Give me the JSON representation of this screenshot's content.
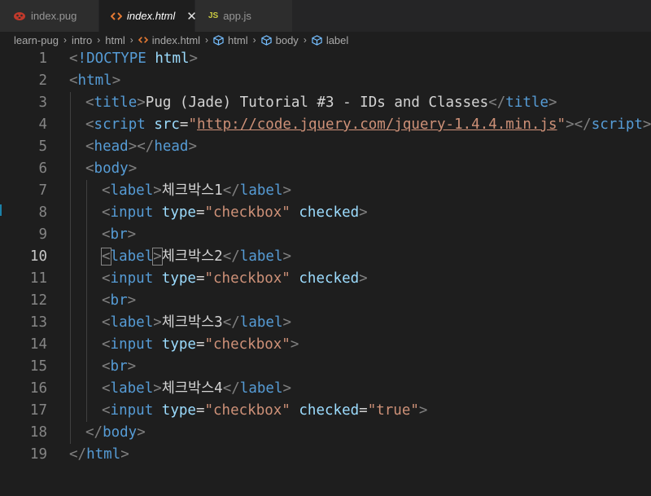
{
  "tabs": [
    {
      "label": "index.pug",
      "icon": "pug-icon",
      "active": false
    },
    {
      "label": "index.html",
      "icon": "html-icon",
      "active": true,
      "close": "✕"
    },
    {
      "label": "app.js",
      "icon": "js-icon",
      "badge": "JS",
      "active": false
    }
  ],
  "breadcrumb": [
    "learn-pug",
    "intro",
    "html",
    "index.html",
    "html",
    "body",
    "label"
  ],
  "colors": {
    "background": "#1e1e1e",
    "tag": "#569cd6",
    "attribute": "#9cdcfe",
    "string": "#ce9178",
    "punctuation": "#808080",
    "text": "#d4d4d4",
    "line_number": "#858585"
  },
  "editor": {
    "current_line": 10,
    "lines": [
      {
        "n": "1",
        "indent": 0,
        "tokens": [
          [
            "punc",
            "<"
          ],
          [
            "kw",
            "!DOCTYPE"
          ],
          [
            "text",
            " "
          ],
          [
            "attr",
            "html"
          ],
          [
            "punc",
            ">"
          ]
        ]
      },
      {
        "n": "2",
        "indent": 0,
        "tokens": [
          [
            "punc",
            "<"
          ],
          [
            "tag",
            "html"
          ],
          [
            "punc",
            ">"
          ]
        ]
      },
      {
        "n": "3",
        "indent": 1,
        "tokens": [
          [
            "punc",
            "<"
          ],
          [
            "tag",
            "title"
          ],
          [
            "punc",
            ">"
          ],
          [
            "text",
            "Pug (Jade) Tutorial #3 - IDs and Classes"
          ],
          [
            "punc",
            "</"
          ],
          [
            "tag",
            "title"
          ],
          [
            "punc",
            ">"
          ]
        ]
      },
      {
        "n": "4",
        "indent": 1,
        "tokens": [
          [
            "punc",
            "<"
          ],
          [
            "tag",
            "script"
          ],
          [
            "text",
            " "
          ],
          [
            "attr",
            "src"
          ],
          [
            "text",
            "="
          ],
          [
            "str",
            "\""
          ],
          [
            "url",
            "http://code.jquery.com/jquery-1.4.4.min.js"
          ],
          [
            "str",
            "\""
          ],
          [
            "punc",
            "></"
          ],
          [
            "tag",
            "script"
          ],
          [
            "punc",
            ">"
          ]
        ]
      },
      {
        "n": "5",
        "indent": 1,
        "tokens": [
          [
            "punc",
            "<"
          ],
          [
            "tag",
            "head"
          ],
          [
            "punc",
            "></"
          ],
          [
            "tag",
            "head"
          ],
          [
            "punc",
            ">"
          ]
        ]
      },
      {
        "n": "6",
        "indent": 1,
        "tokens": [
          [
            "punc",
            "<"
          ],
          [
            "tag",
            "body"
          ],
          [
            "punc",
            ">"
          ]
        ]
      },
      {
        "n": "7",
        "indent": 2,
        "tokens": [
          [
            "punc",
            "<"
          ],
          [
            "tag",
            "label"
          ],
          [
            "punc",
            ">"
          ],
          [
            "text",
            "체크박스1"
          ],
          [
            "punc",
            "</"
          ],
          [
            "tag",
            "label"
          ],
          [
            "punc",
            ">"
          ]
        ]
      },
      {
        "n": "8",
        "indent": 2,
        "tokens": [
          [
            "punc",
            "<"
          ],
          [
            "tag",
            "input"
          ],
          [
            "text",
            " "
          ],
          [
            "attr",
            "type"
          ],
          [
            "text",
            "="
          ],
          [
            "str",
            "\"checkbox\""
          ],
          [
            "text",
            " "
          ],
          [
            "attr",
            "checked"
          ],
          [
            "punc",
            ">"
          ]
        ]
      },
      {
        "n": "9",
        "indent": 2,
        "tokens": [
          [
            "punc",
            "<"
          ],
          [
            "tag",
            "br"
          ],
          [
            "punc",
            ">"
          ]
        ]
      },
      {
        "n": "10",
        "indent": 2,
        "tokens": [
          [
            "box",
            "<"
          ],
          [
            "tag",
            "label"
          ],
          [
            "box",
            ">"
          ],
          [
            "text",
            "체크박스2"
          ],
          [
            "punc",
            "</"
          ],
          [
            "tag",
            "label"
          ],
          [
            "punc",
            ">"
          ]
        ]
      },
      {
        "n": "11",
        "indent": 2,
        "tokens": [
          [
            "punc",
            "<"
          ],
          [
            "tag",
            "input"
          ],
          [
            "text",
            " "
          ],
          [
            "attr",
            "type"
          ],
          [
            "text",
            "="
          ],
          [
            "str",
            "\"checkbox\""
          ],
          [
            "text",
            " "
          ],
          [
            "attr",
            "checked"
          ],
          [
            "punc",
            ">"
          ]
        ]
      },
      {
        "n": "12",
        "indent": 2,
        "tokens": [
          [
            "punc",
            "<"
          ],
          [
            "tag",
            "br"
          ],
          [
            "punc",
            ">"
          ]
        ]
      },
      {
        "n": "13",
        "indent": 2,
        "tokens": [
          [
            "punc",
            "<"
          ],
          [
            "tag",
            "label"
          ],
          [
            "punc",
            ">"
          ],
          [
            "text",
            "체크박스3"
          ],
          [
            "punc",
            "</"
          ],
          [
            "tag",
            "label"
          ],
          [
            "punc",
            ">"
          ]
        ]
      },
      {
        "n": "14",
        "indent": 2,
        "tokens": [
          [
            "punc",
            "<"
          ],
          [
            "tag",
            "input"
          ],
          [
            "text",
            " "
          ],
          [
            "attr",
            "type"
          ],
          [
            "text",
            "="
          ],
          [
            "str",
            "\"checkbox\""
          ],
          [
            "punc",
            ">"
          ]
        ]
      },
      {
        "n": "15",
        "indent": 2,
        "tokens": [
          [
            "punc",
            "<"
          ],
          [
            "tag",
            "br"
          ],
          [
            "punc",
            ">"
          ]
        ]
      },
      {
        "n": "16",
        "indent": 2,
        "tokens": [
          [
            "punc",
            "<"
          ],
          [
            "tag",
            "label"
          ],
          [
            "punc",
            ">"
          ],
          [
            "text",
            "체크박스4"
          ],
          [
            "punc",
            "</"
          ],
          [
            "tag",
            "label"
          ],
          [
            "punc",
            ">"
          ]
        ]
      },
      {
        "n": "17",
        "indent": 2,
        "tokens": [
          [
            "punc",
            "<"
          ],
          [
            "tag",
            "input"
          ],
          [
            "text",
            " "
          ],
          [
            "attr",
            "type"
          ],
          [
            "text",
            "="
          ],
          [
            "str",
            "\"checkbox\""
          ],
          [
            "text",
            " "
          ],
          [
            "attr",
            "checked"
          ],
          [
            "text",
            "="
          ],
          [
            "str",
            "\"true\""
          ],
          [
            "punc",
            ">"
          ]
        ]
      },
      {
        "n": "18",
        "indent": 1,
        "tokens": [
          [
            "punc",
            "</"
          ],
          [
            "tag",
            "body"
          ],
          [
            "punc",
            ">"
          ]
        ]
      },
      {
        "n": "19",
        "indent": 0,
        "tokens": [
          [
            "punc",
            "</"
          ],
          [
            "tag",
            "html"
          ],
          [
            "punc",
            ">"
          ]
        ]
      }
    ]
  }
}
